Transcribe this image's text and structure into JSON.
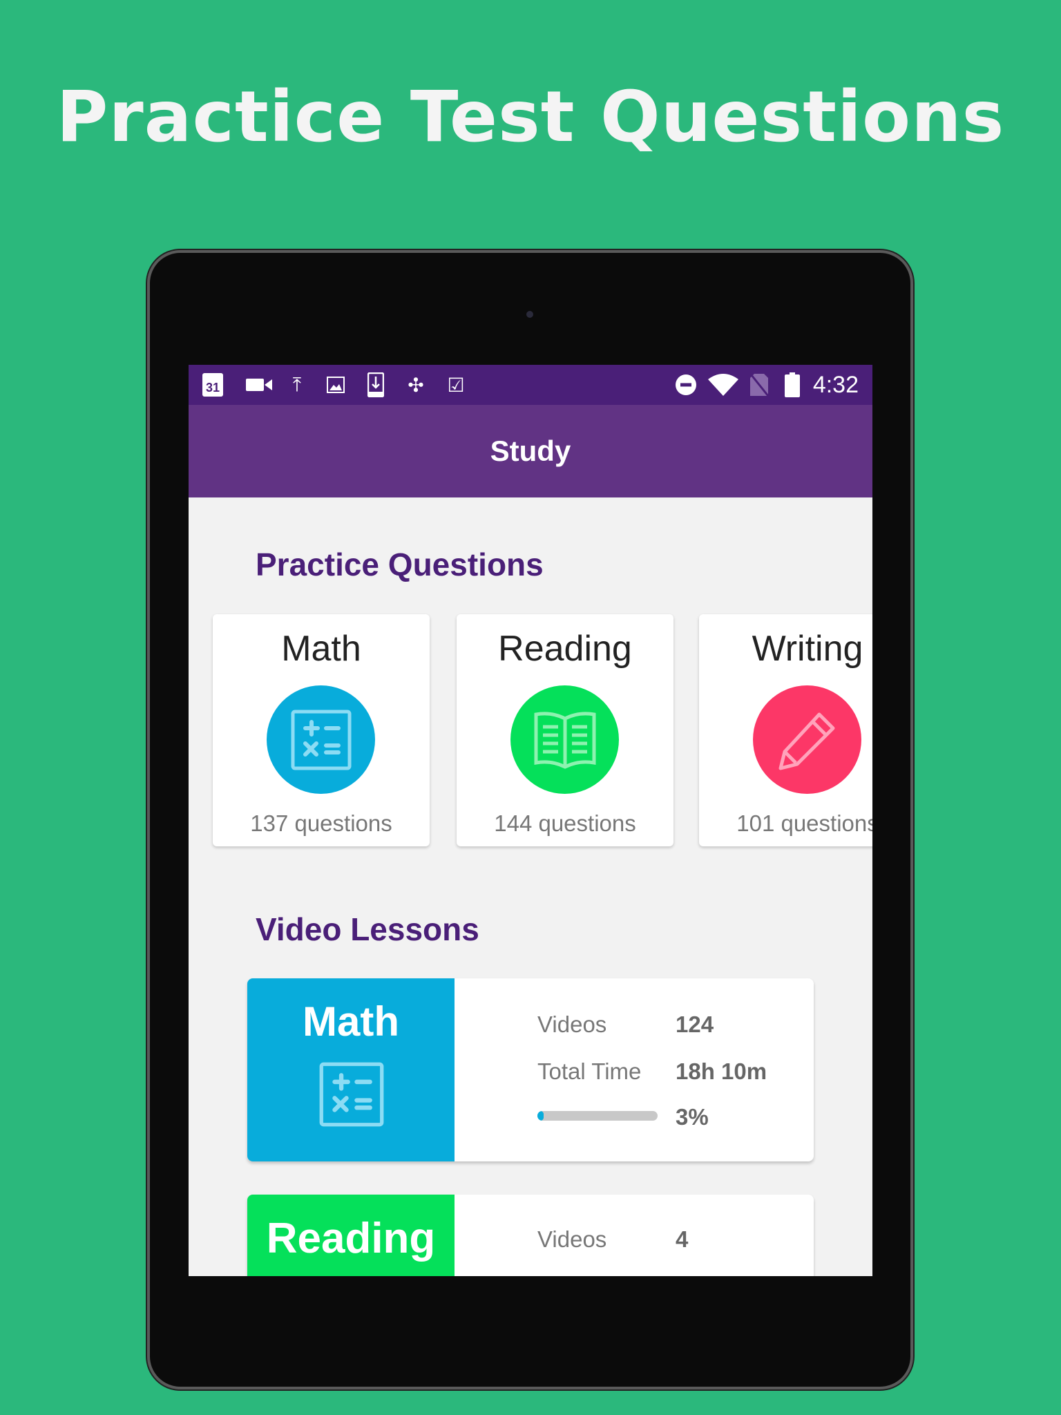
{
  "headline": "Practice Test Questions",
  "status_bar": {
    "time": "4:32",
    "icons_left": [
      "calendar-icon",
      "video-camera-icon",
      "upload-icon",
      "image-icon",
      "download-icon",
      "pinwheel-icon",
      "clipboard-check-icon"
    ],
    "calendar_day": "31",
    "icons_right": [
      "do-not-disturb-icon",
      "wifi-icon",
      "no-sim-icon",
      "battery-icon"
    ]
  },
  "app_bar": {
    "title": "Study",
    "color": "#613384"
  },
  "practice": {
    "title": "Practice Questions",
    "cards": [
      {
        "subject": "Math",
        "count": "137 questions",
        "color": "#08acdb",
        "icon": "calculator-icon"
      },
      {
        "subject": "Reading",
        "count": "144 questions",
        "color": "#05e05a",
        "icon": "book-icon"
      },
      {
        "subject": "Writing",
        "count": "101 questions",
        "color": "#fc3767",
        "icon": "pencil-icon"
      }
    ]
  },
  "videos": {
    "title": "Video Lessons",
    "cards": [
      {
        "subject": "Math",
        "color": "#08acdb",
        "videos_label": "Videos",
        "videos": "124",
        "time_label": "Total Time",
        "time": "18h 10m",
        "progress": 3,
        "progress_label": "3%"
      },
      {
        "subject": "Reading",
        "color": "#05e05a",
        "videos_label": "Videos",
        "videos": "4"
      }
    ]
  }
}
